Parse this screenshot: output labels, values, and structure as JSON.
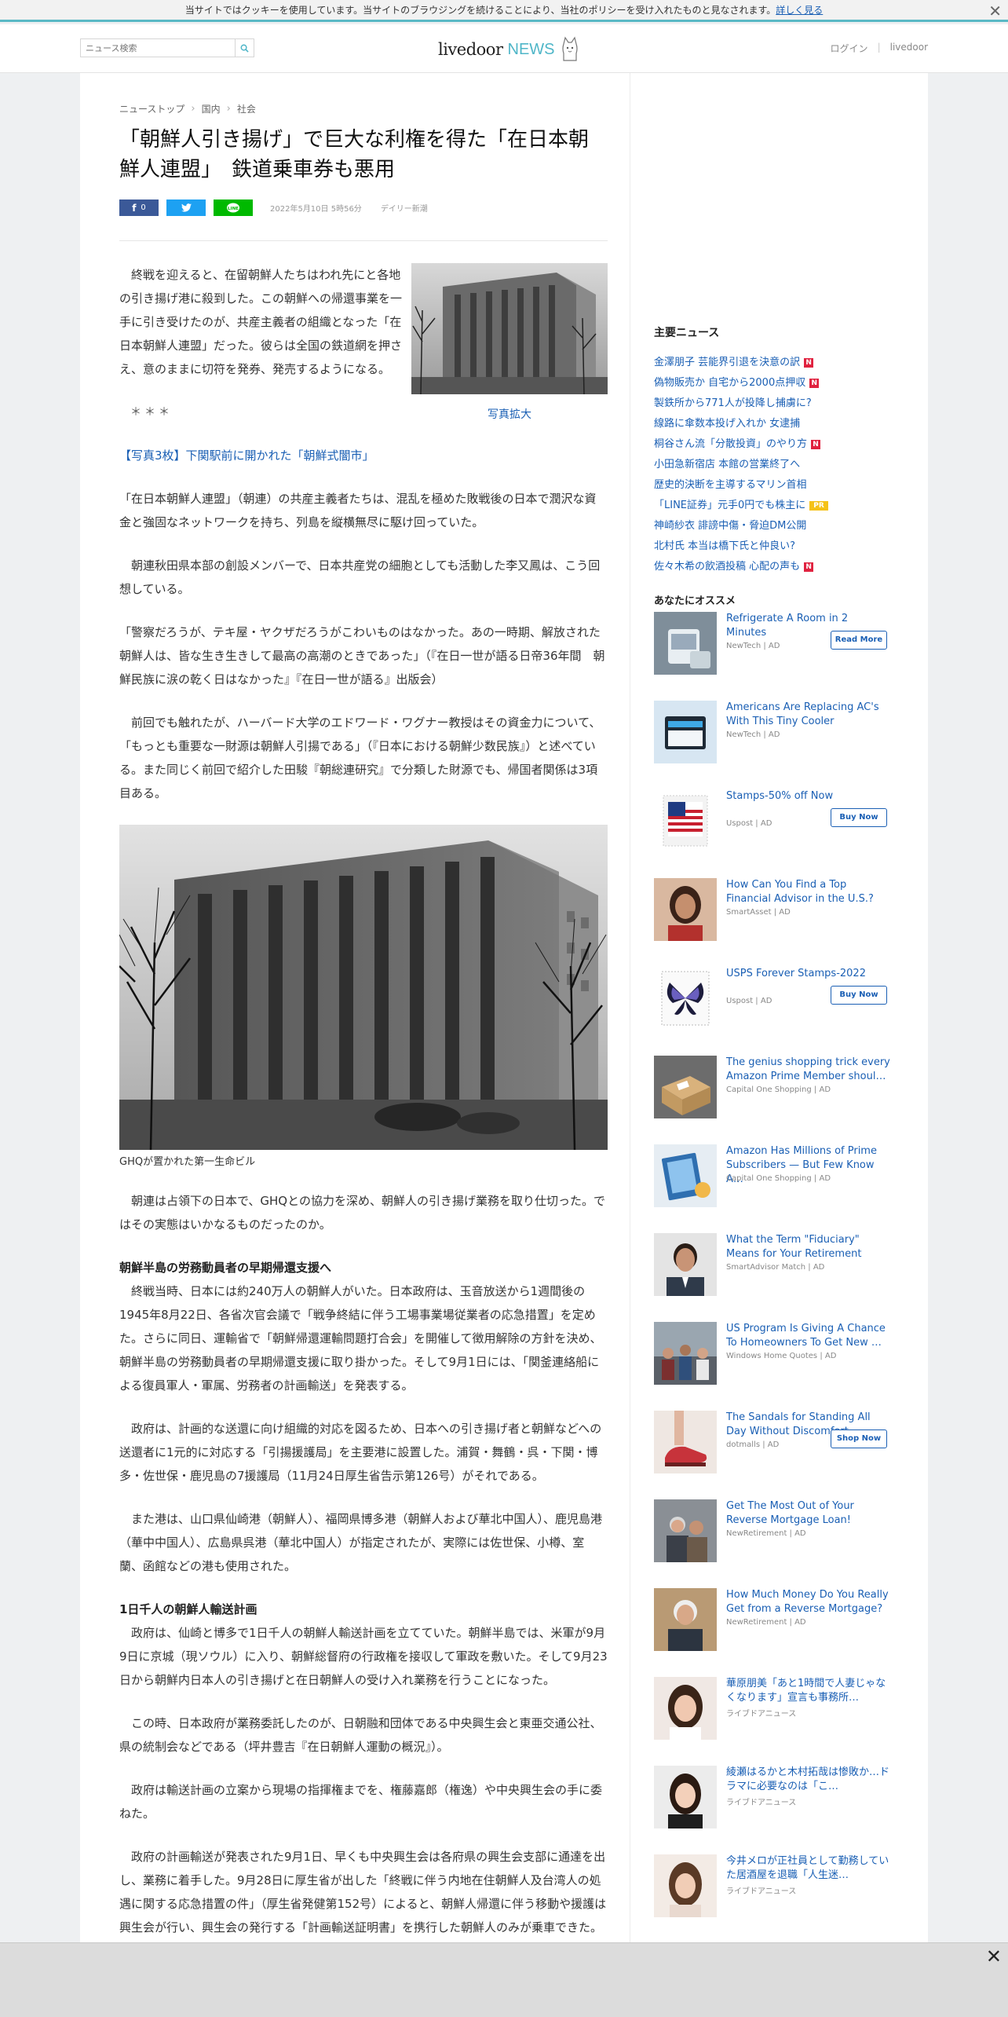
{
  "cookie": {
    "text": "当サイトではクッキーを使用しています。当サイトのブラウジングを続けることにより、当社のポリシーを受け入れたものと見なされます。",
    "link": "詳しく見る"
  },
  "header": {
    "search_placeholder": "ニュース検索",
    "logo_main": "livedoor",
    "logo_news": "NEWS",
    "login": "ログイン",
    "site": "livedoor"
  },
  "breadcrumb": [
    "ニューストップ",
    "国内",
    "社会"
  ],
  "article": {
    "title": "「朝鮮人引き揚げ」で巨大な利権を得た「在日本朝鮮人連盟」　鉄道乗車券も悪用",
    "fb_count": "0",
    "date": "2022年5月10日 5時56分",
    "source": "デイリー新潮",
    "lead": "終戦を迎えると、在留朝鮮人たちはわれ先にと各地の引き揚げ港に殺到した。この朝鮮への帰還事業を一手に引き受けたのが、共産主義者の組織となった「在日本朝鮮人連盟」だった。彼らは全国の鉄道網を押さえ、意のままに切符を発券、発売するようになる。",
    "enlarge": "写真拡大",
    "stars": "＊＊＊",
    "photo_link": "【写真3枚】下関駅前に開かれた「朝鮮式闇市」",
    "p1": "「在日本朝鮮人連盟」（朝連）の共産主義者たちは、混乱を極めた敗戦後の日本で潤沢な資金と強固なネットワークを持ち、列島を縦横無尽に駆け回っていた。",
    "p2": "朝連秋田県本部の創設メンバーで、日本共産党の細胞としても活動した李又鳳は、こう回想している。",
    "p3": "「警察だろうが、テキ屋・ヤクザだろうがこわいものはなかった。あの一時期、解放された朝鮮人は、皆な生き生きして最高の高潮のときであった」（『在日一世が語る日帝36年間　朝鮮民族に涙の乾く日はなかった』『在日一世が語る』出版会）",
    "p4": "前回でも触れたが、ハーバード大学のエドワード・ワグナー教授はその資金力について、「もっとも重要な一財源は朝鮮人引揚である」（『日本における朝鮮少数民族』）と述べている。また同じく前回で紹介した田駿『朝総連研究』で分類した財源でも、帰国者関係は3項目ある。",
    "caption": "GHQが置かれた第一生命ビル",
    "p5": "朝連は占領下の日本で、GHQとの協力を深め、朝鮮人の引き揚げ業務を取り仕切った。ではその実態はいかなるものだったのか。",
    "h1": "朝鮮半島の労務動員者の早期帰還支援へ",
    "p6": "終戦当時、日本には約240万人の朝鮮人がいた。日本政府は、玉音放送から1週間後の1945年8月22日、各省次官会議で「戦争終結に伴う工場事業場従業者の応急措置」を定めた。さらに同日、運輸省で「朝鮮帰還運輸問題打合会」を開催して徴用解除の方針を決め、朝鮮半島の労務動員者の早期帰還支援に取り掛かった。そして9月1日には、「関釜連絡船による復員軍人・軍属、労務者の計画輸送」を発表する。",
    "p7": "政府は、計画的な送還に向け組織的対応を図るため、日本への引き揚げ者と朝鮮などへの送還者に1元的に対応する「引揚援護局」を主要港に設置した。浦賀・舞鶴・呉・下関・博多・佐世保・鹿児島の7援護局（11月24日厚生省告示第126号）がそれである。",
    "p8": "また港は、山口県仙崎港（朝鮮人）、福岡県博多港（朝鮮人および華北中国人）、鹿児島港（華中中国人）、広島県呉港（華北中国人）が指定されたが、実際には佐世保、小樽、室蘭、函館などの港も使用された。",
    "h2": "1日千人の朝鮮人輸送計画",
    "p9": "政府は、仙崎と博多で1日千人の朝鮮人輸送計画を立てていた。朝鮮半島では、米軍が9月9日に京城（現ソウル）に入り、朝鮮総督府の行政権を接収して軍政を敷いた。そして9月23日から朝鮮内日本人の引き揚げと在日朝鮮人の受け入れ業務を行うことになった。",
    "p10": "この時、日本政府が業務委託したのが、日朝融和団体である中央興生会と東亜交通公社、県の統制会などである（坪井豊吉『在日朝鮮人運動の概況』）。",
    "p11": "政府は輸送計画の立案から現場の指揮権までを、権藤嘉郎（権逸）や中央興生会の手に委ねた。",
    "p12": "政府の計画輸送が発表された9月1日、早くも中央興生会は各府県の興生会支部に通達を出し、業務に着手した。9月28日に厚生省が出した「終戦に伴う内地在住朝鮮人及台湾人の処遇に関する応急措置の件」（厚生省発健第152号）によると、朝鮮人帰還に伴う移動や援護は興生会が行い、興生会の発行する「計画輸送証明書」を携行した朝鮮人のみが乗車できた。"
  },
  "sidebar": {
    "main_news_heading": "主要ニュース",
    "main_news": [
      {
        "title": "金澤朋子 芸能界引退を決意の訳",
        "badge": "N"
      },
      {
        "title": "偽物販売か 自宅から2000点押収",
        "badge": "N"
      },
      {
        "title": "製鉄所から771人が投降し捕虜に?",
        "badge": ""
      },
      {
        "title": "線路に傘数本投げ入れか 女逮捕",
        "badge": ""
      },
      {
        "title": "桐谷さん流「分散投資」のやり方",
        "badge": "N"
      },
      {
        "title": "小田急新宿店 本館の営業終了へ",
        "badge": ""
      },
      {
        "title": "歴史的決断を主導するマリン首相",
        "badge": ""
      },
      {
        "title": "「LINE証券」元手0円でも株主に",
        "badge": "PR"
      },
      {
        "title": "神崎紗衣 誹謗中傷・脅迫DM公開",
        "badge": ""
      },
      {
        "title": "北村氏 本当は橋下氏と仲良い?",
        "badge": ""
      },
      {
        "title": "佐々木希の飲酒投稿 心配の声も",
        "badge": "N"
      }
    ],
    "recommend_heading": "あなたにオススメ",
    "ads": [
      {
        "title": "Refrigerate A Room in 2 Minutes",
        "source": "NewTech | AD",
        "button": "Read More"
      },
      {
        "title": "Americans Are Replacing AC's With This Tiny Cooler",
        "source": "NewTech | AD",
        "button": ""
      },
      {
        "title": "Stamps-50% off Now",
        "source": "Uspost | AD",
        "button": "Buy Now"
      },
      {
        "title": "How Can You Find a Top Financial Advisor in the U.S.?",
        "source": "SmartAsset | AD",
        "button": ""
      },
      {
        "title": "USPS Forever Stamps-2022",
        "source": "Uspost | AD",
        "button": "Buy Now"
      },
      {
        "title": "The genius shopping trick every Amazon Prime Member shoul…",
        "source": "Capital One Shopping | AD",
        "button": ""
      },
      {
        "title": "Amazon Has Millions of Prime Subscribers — But Few Know A…",
        "source": "Capital One Shopping | AD",
        "button": ""
      },
      {
        "title": "What the Term \"Fiduciary\" Means for Your Retirement",
        "source": "SmartAdvisor Match | AD",
        "button": ""
      },
      {
        "title": "US Program Is Giving A Chance To Homeowners To Get New …",
        "source": "Windows Home Quotes | AD",
        "button": ""
      },
      {
        "title": "The Sandals for Standing All Day Without Discomfort",
        "source": "dotmalls | AD",
        "button": "Shop Now"
      },
      {
        "title": "Get The Most Out of Your Reverse Mortgage Loan!",
        "source": "NewRetirement | AD",
        "button": ""
      },
      {
        "title": "How Much Money Do You Really Get from a Reverse Mortgage?",
        "source": "NewRetirement | AD",
        "button": ""
      },
      {
        "title": "華原朋美「あと1時間で人妻じゃなくなります」宣言も事務所…",
        "source": "ライブドアニュース",
        "button": ""
      },
      {
        "title": "綾瀬はるかと木村拓哉は惨敗か…ドラマに必要なのは「こ…",
        "source": "ライブドアニュース",
        "button": ""
      },
      {
        "title": "今井メロが正社員として勤務していた居酒屋を退職「人生迷…",
        "source": "ライブドアニュース",
        "button": ""
      }
    ]
  },
  "colors": {
    "link": "#1a5fb4",
    "accent": "#5ab9c5",
    "badge_new": "#e0223f",
    "badge_pr": "#f5c218",
    "facebook": "#3b5998",
    "twitter": "#1da1f2",
    "line": "#00b900"
  }
}
